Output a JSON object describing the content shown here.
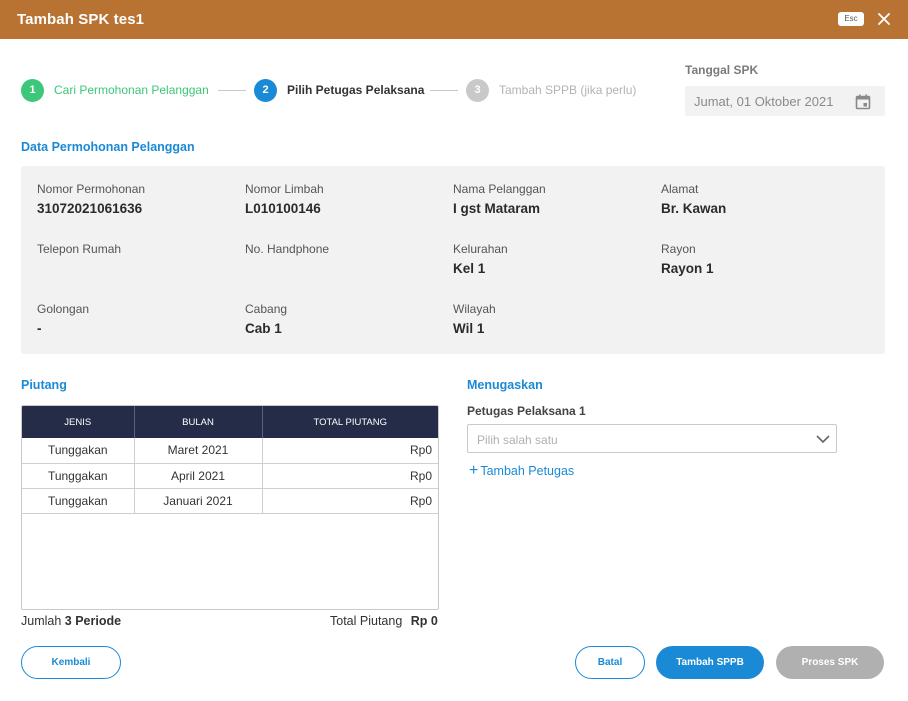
{
  "header": {
    "title": "Tambah SPK  tes1",
    "esc_label": "Esc",
    "close_icon": "close-icon"
  },
  "steps": [
    {
      "number": "1",
      "label": "Cari Permohonan Pelanggan",
      "state": "done",
      "color": "#3cc77b"
    },
    {
      "number": "2",
      "label": "Pilih Petugas Pelaksana",
      "state": "active",
      "color": "#1a8ad6"
    },
    {
      "number": "3",
      "label": "Tambah  SPPB (jika perlu)",
      "state": "pending",
      "color": "#c9c9c9"
    }
  ],
  "tanggal": {
    "label": "Tanggal SPK",
    "value": "Jumat, 01 Oktober 2021",
    "icon": "calendar-icon"
  },
  "data_permohonan": {
    "title": "Data Permohonan Pelanggan",
    "fields": [
      {
        "label": "Nomor Permohonan",
        "value": "31072021061636"
      },
      {
        "label": "Nomor Limbah",
        "value": "L010100146"
      },
      {
        "label": "Nama Pelanggan",
        "value": "I gst Mataram"
      },
      {
        "label": "Alamat",
        "value": "Br. Kawan"
      },
      {
        "label": "Telepon Rumah",
        "value": ""
      },
      {
        "label": "No. Handphone",
        "value": ""
      },
      {
        "label": "Kelurahan",
        "value": "Kel 1"
      },
      {
        "label": "Rayon",
        "value": "Rayon 1"
      },
      {
        "label": "Golongan",
        "value": "-"
      },
      {
        "label": "Cabang",
        "value": "Cab 1"
      },
      {
        "label": "Wilayah",
        "value": "Wil 1"
      }
    ]
  },
  "piutang": {
    "title": "Piutang",
    "columns": [
      "JENIS",
      "BULAN",
      "TOTAL PIUTANG"
    ],
    "rows": [
      {
        "jenis": "Tunggakan",
        "bulan": "Maret 2021",
        "total": "Rp0"
      },
      {
        "jenis": "Tunggakan",
        "bulan": "April 2021",
        "total": "Rp0"
      },
      {
        "jenis": "Tunggakan",
        "bulan": "Januari 2021",
        "total": "Rp0"
      }
    ],
    "jumlah_prefix": "Jumlah",
    "jumlah_value": "3 Periode",
    "total_label": "Total Piutang",
    "total_value": "Rp 0"
  },
  "menugaskan": {
    "title": "Menugaskan",
    "petugas_label": "Petugas Pelaksana 1",
    "select_placeholder": "Pilih salah satu",
    "add_label": "Tambah Petugas",
    "add_icon": "+"
  },
  "buttons": {
    "kembali": "Kembali",
    "batal": "Batal",
    "tambah_sppb": "Tambah SPPB",
    "proses_spk": "Proses SPK"
  },
  "colors": {
    "header": "#b87333",
    "accent": "#1a8ad6",
    "done": "#3cc77b",
    "table_head": "#252c48",
    "disabled": "#b0b0b0"
  }
}
